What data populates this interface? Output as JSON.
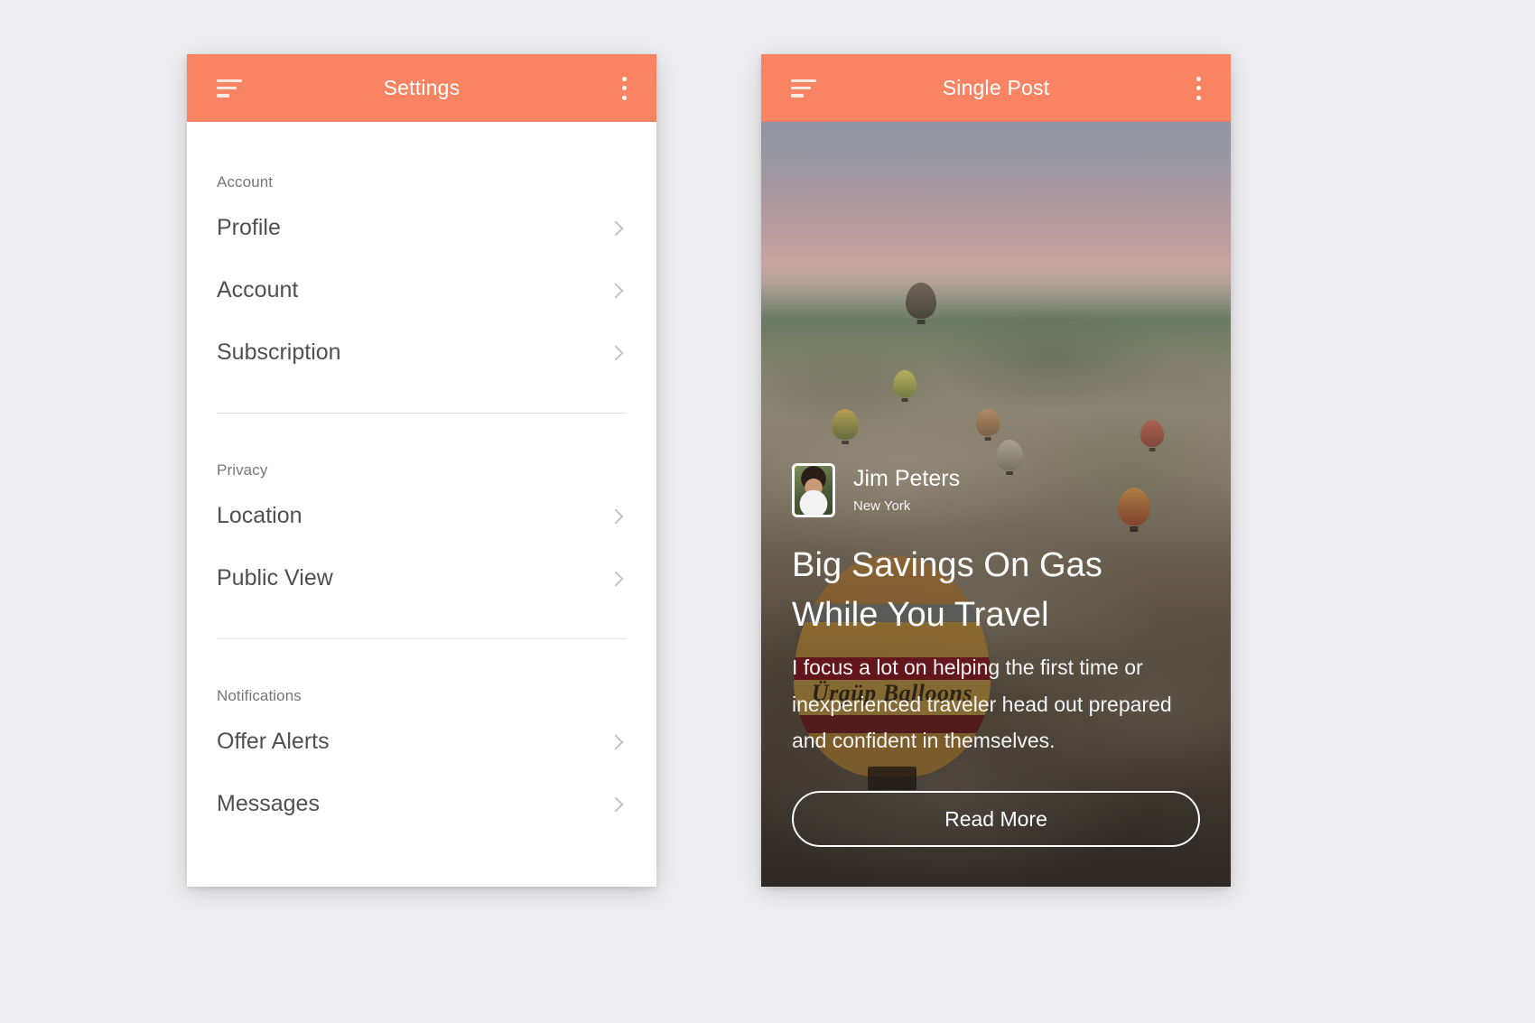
{
  "theme": {
    "accent": "#f98463",
    "appbar_text": "#ffffff",
    "page_background": "#efeff1",
    "card_background": "#ffffff",
    "list_text": "#505050",
    "group_label_text": "#777777",
    "chevron": "#c4c4c4"
  },
  "settings_screen": {
    "appbar": {
      "title": "Settings",
      "menu_icon": "hamburger-menu-icon",
      "overflow_icon": "kebab-menu-icon"
    },
    "groups": [
      {
        "label": "Account",
        "items": [
          {
            "label": "Profile",
            "chevron": "chevron-right-icon"
          },
          {
            "label": "Account",
            "chevron": "chevron-right-icon"
          },
          {
            "label": "Subscription",
            "chevron": "chevron-right-icon"
          }
        ]
      },
      {
        "label": "Privacy",
        "items": [
          {
            "label": "Location",
            "chevron": "chevron-right-icon"
          },
          {
            "label": "Public View",
            "chevron": "chevron-right-icon"
          }
        ]
      },
      {
        "label": "Notifications",
        "items": [
          {
            "label": "Offer Alerts",
            "chevron": "chevron-right-icon"
          },
          {
            "label": "Messages",
            "chevron": "chevron-right-icon"
          }
        ]
      }
    ]
  },
  "post_screen": {
    "appbar": {
      "title": "Single Post",
      "menu_icon": "hamburger-menu-icon",
      "overflow_icon": "kebab-menu-icon"
    },
    "hero": {
      "description": "Aerial dusk photo of hot air balloons over Cappadocia rock valley",
      "balloon_label": "Ürgüp Balloons"
    },
    "author": {
      "name": "Jim Peters",
      "location": "New York",
      "avatar": "user-avatar"
    },
    "title": "Big Savings On Gas While You Travel",
    "excerpt": "I focus a lot on helping the first time or inexperienced traveler head out prepared and confident in themselves.",
    "read_more_label": "Read More"
  }
}
